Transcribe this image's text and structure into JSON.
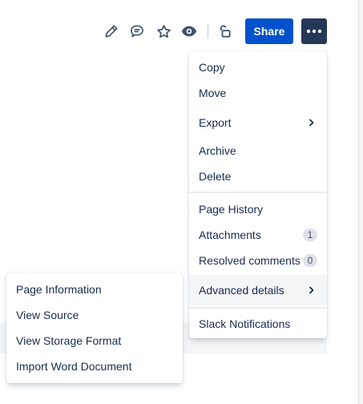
{
  "toolbar": {
    "icons": [
      "pencil-icon",
      "comment-icon",
      "star-icon",
      "eye-icon",
      "unlock-icon"
    ],
    "share_label": "Share",
    "more_icon": "ellipsis-icon"
  },
  "menu": {
    "copy": "Copy",
    "move": "Move",
    "export": "Export",
    "archive": "Archive",
    "delete": "Delete",
    "page_history": "Page History",
    "attachments": "Attachments",
    "attachments_count": "1",
    "resolved_comments": "Resolved comments",
    "resolved_comments_count": "0",
    "advanced_details": "Advanced details",
    "slack_notifications": "Slack Notifications"
  },
  "submenu": {
    "page_information": "Page Information",
    "view_source": "View Source",
    "view_storage_format": "View Storage Format",
    "import_word_document": "Import Word Document"
  },
  "colors": {
    "primary": "#0052cc",
    "more_button": "#253858",
    "icon": "#42526e",
    "text": "#172b4d"
  }
}
